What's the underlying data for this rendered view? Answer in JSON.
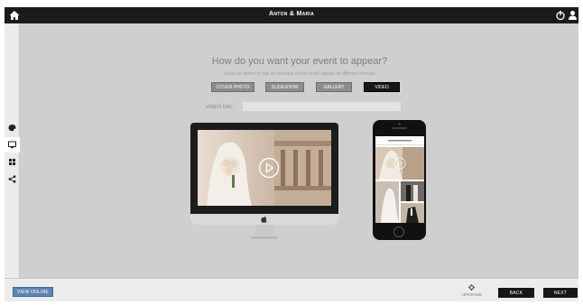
{
  "topbar": {
    "title": "Anton & Maria",
    "home_icon": "home-icon",
    "power_icon": "power-icon",
    "user_icon": "user-icon",
    "background": "#1b1b1b"
  },
  "sidebar": {
    "items": [
      {
        "icon": "palette-icon",
        "active": false
      },
      {
        "icon": "devices-icon",
        "active": true
      },
      {
        "icon": "grid-icon",
        "active": false
      },
      {
        "icon": "share-icon",
        "active": false
      }
    ]
  },
  "main": {
    "heading": "How do you want your event to appear?",
    "subheading": "Select an option to see an example of how it will appear on different devices.",
    "options": [
      {
        "label": "COVER PHOTO",
        "selected": false
      },
      {
        "label": "SLIDESHOW",
        "selected": false
      },
      {
        "label": "GALLERY",
        "selected": false
      },
      {
        "label": "VIDEO",
        "selected": true
      }
    ],
    "video_url_label": "VIDEO URL:",
    "video_url_value": "",
    "video_url_placeholder": ""
  },
  "preview": {
    "monitor": "desktop-monitor",
    "phone": "mobile-phone",
    "play_icon": "play-icon"
  },
  "footer": {
    "view_online": "VIEW ONLINE",
    "upgrade": "UPGRADE",
    "back": "BACK",
    "next": "NEXT",
    "accent": "#5d84b1"
  }
}
